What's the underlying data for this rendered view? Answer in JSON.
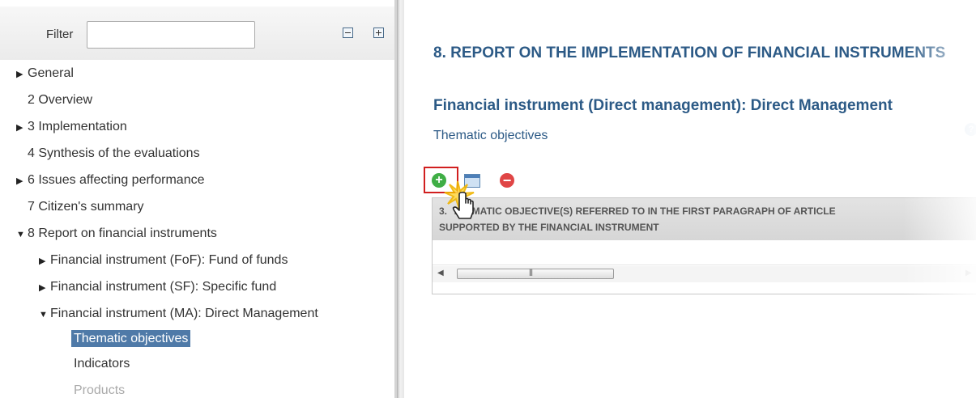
{
  "filter": {
    "label": "Filter",
    "value": "",
    "collapse_icon": "collapse-all-icon",
    "expand_icon": "expand-all-icon"
  },
  "tree": {
    "items": [
      {
        "label": "General",
        "arrow": "▶"
      },
      {
        "label": "2 Overview",
        "arrow": ""
      },
      {
        "label": "3 Implementation",
        "arrow": "▶"
      },
      {
        "label": "4 Synthesis of the evaluations",
        "arrow": ""
      },
      {
        "label": "6 Issues affecting performance",
        "arrow": "▶"
      },
      {
        "label": "7 Citizen's summary",
        "arrow": ""
      },
      {
        "label": "8 Report on financial instruments",
        "arrow": "▼"
      },
      {
        "label": "Financial instrument (FoF): Fund of funds",
        "arrow": "▶"
      },
      {
        "label": "Financial instrument (SF): Specific fund",
        "arrow": "▶"
      },
      {
        "label": "Financial instrument (MA): Direct Management",
        "arrow": "▼"
      },
      {
        "label": "Thematic objectives",
        "arrow": ""
      },
      {
        "label": "Indicators",
        "arrow": ""
      },
      {
        "label": "Products",
        "arrow": ""
      }
    ]
  },
  "content": {
    "page_title": "8. REPORT ON THE IMPLEMENTATION OF FINANCIAL INSTRUMENTS",
    "sub_title": "Financial instrument (Direct management): Direct Management",
    "section_label": "Thematic objectives",
    "help_icon": "help-icon",
    "toolbar": {
      "add": "+",
      "delete": "−"
    },
    "grid": {
      "header_line1": "3.  THEMATIC OBJECTIVE(S) REFERRED TO IN THE FIRST PARAGRAPH OF ARTICLE",
      "header_line2": "SUPPORTED BY THE FINANCIAL INSTRUMENT",
      "scroll_left": "◀",
      "scroll_right": "▶"
    }
  },
  "colors": {
    "title": "#2c5a86",
    "selected_bg": "#4f7aa8",
    "add_green": "#3fae45",
    "delete_red": "#e04545",
    "highlight_red": "#d11f1f"
  }
}
